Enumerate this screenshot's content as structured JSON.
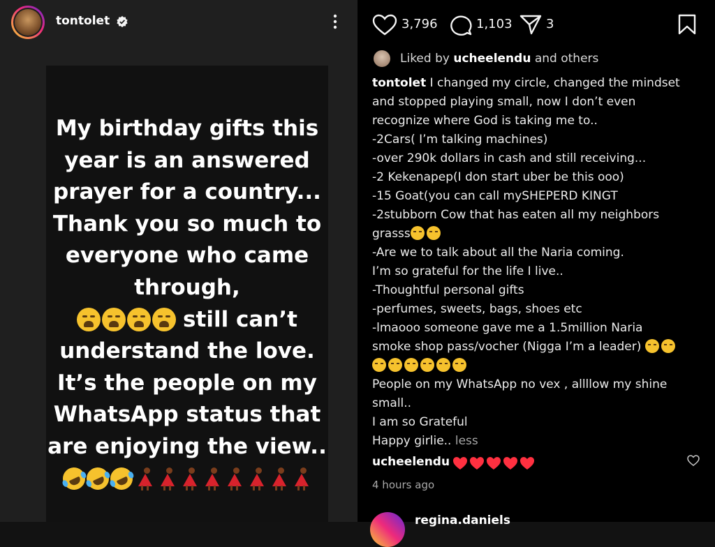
{
  "post": {
    "username": "tontolet",
    "story_lines": [
      "My birthday gifts this",
      "year is an answered",
      "prayer for a country...",
      "Thank you so much to",
      "everyone who came",
      "through,",
      "still can’t",
      "understand the love.",
      "It’s the people on my",
      "WhatsApp status that",
      "are enjoying the view.."
    ]
  },
  "actions": {
    "likes": "3,796",
    "comments": "1,103",
    "shares": "3"
  },
  "liked_by": {
    "prefix": "Liked by",
    "user": "ucheelendu",
    "suffix": "and others"
  },
  "caption": {
    "user": "tontolet",
    "lines": [
      "I changed my circle, changed the mindset",
      "and stopped playing small, now I don’t even",
      "recognize where God is taking me to..",
      "-2Cars( I’m talking machines)",
      "-over 290k dollars in cash and still receiving...",
      "-2 Kekenapep(I don start uber be this ooo)",
      "-15 Goat(you can call mySHEPERD KINGT",
      "-2stubborn Cow that has eaten all my neighbors",
      "grasss",
      "-Are we to talk about all the Naria coming.",
      "I’m so grateful for the life I live..",
      "-Thoughtful personal gifts",
      "-perfumes, sweets, bags, shoes etc",
      "-lmaooo someone gave me a 1.5million Naria",
      "smoke shop pass/vocher (Nigga I’m a leader)",
      "",
      "People on my WhatsApp no vex , allllow my shine",
      "small..",
      "I am so Grateful",
      "Happy girlie.."
    ],
    "less_label": "less"
  },
  "comment": {
    "user": "ucheelendu",
    "time": "4 hours ago"
  },
  "next_comment": {
    "user": "regina.daniels"
  },
  "colors": {
    "accent_verified": "#3797f0",
    "heart": "#ff3040"
  }
}
